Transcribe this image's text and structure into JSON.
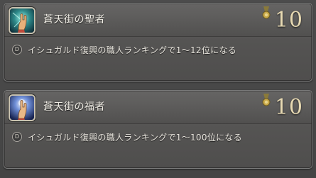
{
  "achievements": [
    {
      "title": "蒼天街の聖者",
      "icon": "saint-hand-icon",
      "icon_bg": "#2e8a8a",
      "points": "10",
      "bullet": "D",
      "description": "イシュガルド復興の職人ランキングで1～12位になる"
    },
    {
      "title": "蒼天街の福者",
      "icon": "blessed-hand-icon",
      "icon_bg": "#3a5bb0",
      "points": "10",
      "bullet": "D",
      "description": "イシュガルド復興の職人ランキングで1～100位になる"
    }
  ],
  "colors": {
    "points": "#e7d9b2",
    "medal": "#c8a848"
  }
}
